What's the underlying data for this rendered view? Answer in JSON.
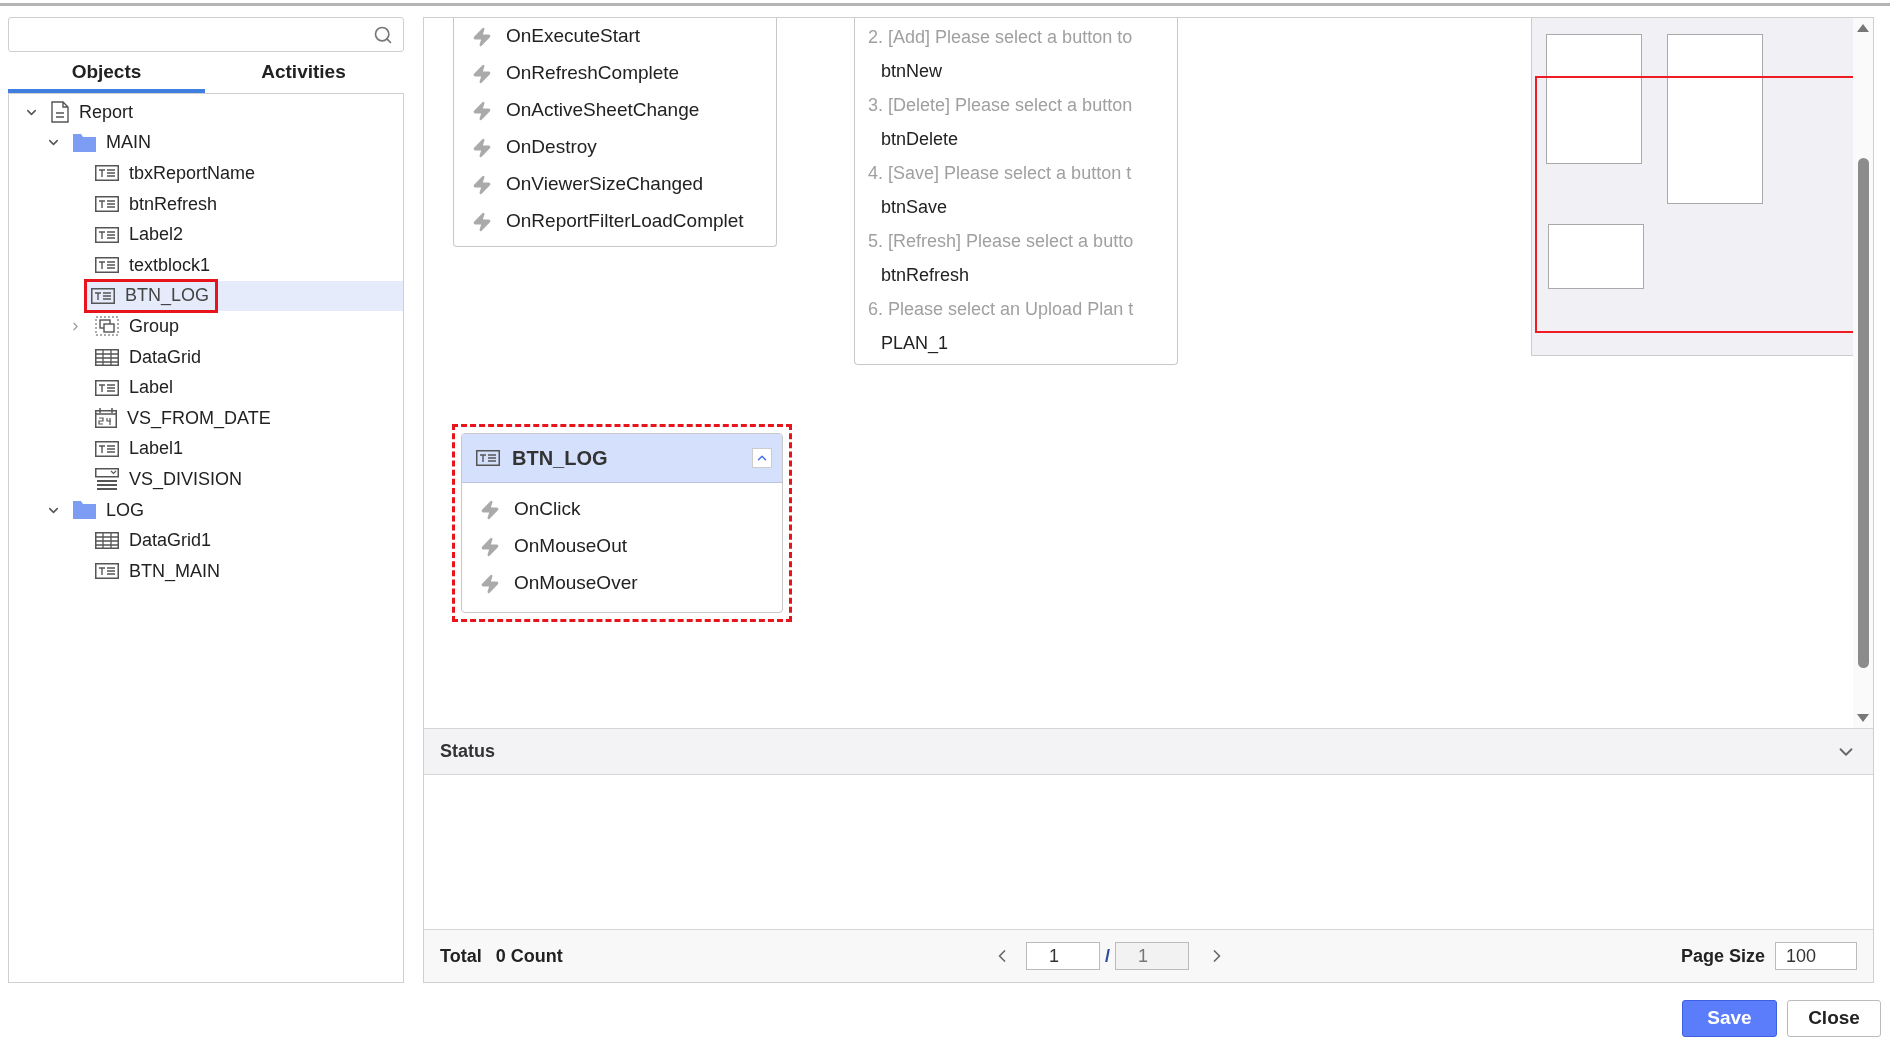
{
  "tabs": [
    {
      "label": "Objects",
      "selected": true
    },
    {
      "label": "Activities",
      "selected": false
    }
  ],
  "tree": [
    {
      "label": "Report",
      "kind": "document",
      "expanded": true,
      "selected": false,
      "children": [
        {
          "label": "MAIN",
          "kind": "folder",
          "expanded": true,
          "selected": false,
          "children": [
            {
              "label": "tbxReportName",
              "kind": "text",
              "selected": false
            },
            {
              "label": "btnRefresh",
              "kind": "text",
              "selected": false
            },
            {
              "label": "Label2",
              "kind": "text",
              "selected": false
            },
            {
              "label": "textblock1",
              "kind": "text",
              "selected": false
            },
            {
              "label": "BTN_LOG",
              "kind": "text",
              "selected": true
            },
            {
              "label": "Group",
              "kind": "group",
              "expanded": false,
              "selected": false
            },
            {
              "label": "DataGrid",
              "kind": "grid",
              "selected": false
            },
            {
              "label": "Label",
              "kind": "text",
              "selected": false
            },
            {
              "label": "VS_FROM_DATE",
              "kind": "date",
              "selected": false
            },
            {
              "label": "Label1",
              "kind": "text",
              "selected": false
            },
            {
              "label": "VS_DIVISION",
              "kind": "combo",
              "selected": false
            }
          ]
        },
        {
          "label": "LOG",
          "kind": "folder",
          "expanded": true,
          "selected": false,
          "children": [
            {
              "label": "DataGrid1",
              "kind": "grid",
              "selected": false
            },
            {
              "label": "BTN_MAIN",
              "kind": "text",
              "selected": false
            }
          ]
        }
      ]
    }
  ],
  "canvas_cards": [
    {
      "kind": "events",
      "events": [
        "OnExecuteStart",
        "OnRefreshComplete",
        "OnActiveSheetChange",
        "OnDestroy",
        "OnViewerSizeChanged",
        "OnReportFilterLoadComplet"
      ]
    },
    {
      "kind": "mapping",
      "rows": [
        {
          "hint": "2. [Add] Please select a button to",
          "value": "btnNew"
        },
        {
          "hint": "3. [Delete] Please select a button",
          "value": "btnDelete"
        },
        {
          "hint": "4. [Save] Please select a button t",
          "value": "btnSave"
        },
        {
          "hint": "5. [Refresh] Please select a butto",
          "value": "btnRefresh"
        },
        {
          "hint": "6. Please select an Upload Plan t",
          "value": "PLAN_1"
        }
      ]
    },
    {
      "kind": "object",
      "title": "BTN_LOG",
      "expanded": true,
      "outlined": true,
      "events": [
        "OnClick",
        "OnMouseOut",
        "OnMouseOver"
      ]
    }
  ],
  "status": {
    "title": "Status",
    "expanded": false
  },
  "footer": {
    "total_label": "Total",
    "count": "0 Count",
    "page": "1",
    "separator": "/",
    "pages": "1",
    "page_size_label": "Page Size",
    "page_size": "100"
  },
  "buttons": [
    {
      "label": "Save",
      "kind": "primary"
    },
    {
      "label": "Close",
      "kind": "secondary"
    }
  ]
}
